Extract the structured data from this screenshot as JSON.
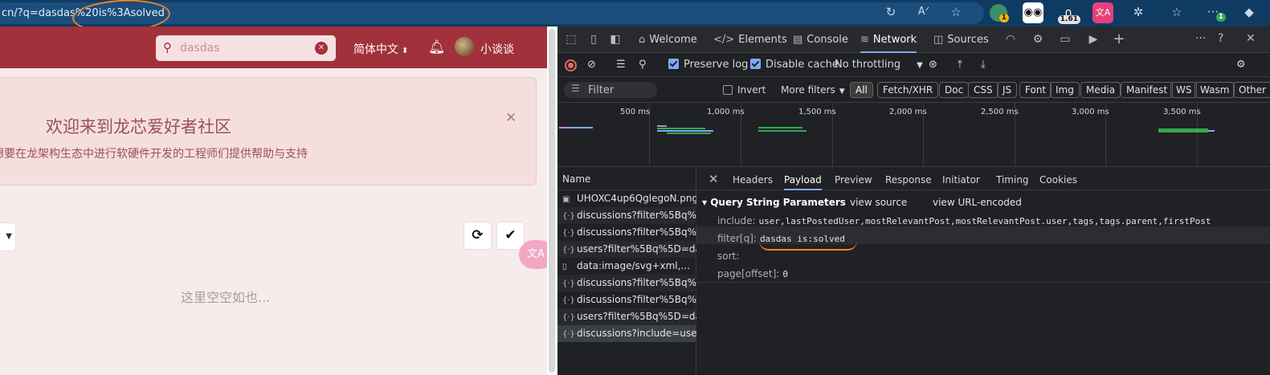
{
  "browser": {
    "url": "cn/?q=dasdas%20is%3Asolved",
    "ext_badges": {
      "ext1": "1",
      "ext3": "1.61",
      "ext_last": "1"
    }
  },
  "page": {
    "search_value": "dasdas",
    "language": "简体中文",
    "username": "小谈谈",
    "welcome_title": "欢迎来到龙芯爱好者社区",
    "welcome_subtitle": "想要在龙架构生态中进行软硬件开发的工程师们提供帮助与支持",
    "empty_text": "这里空空如也...",
    "translate_label": "文A"
  },
  "devtools": {
    "tabs": [
      {
        "label": "Welcome",
        "icon": "home-icon"
      },
      {
        "label": "Elements",
        "icon": "code-icon"
      },
      {
        "label": "Console",
        "icon": "console-icon"
      },
      {
        "label": "Network",
        "icon": "wifi-icon"
      },
      {
        "label": "Sources",
        "icon": "sources-icon"
      }
    ],
    "toolbar": {
      "preserve_log": "Preserve log",
      "disable_cache": "Disable cache",
      "throttling": "No throttling"
    },
    "filter": {
      "placeholder": "Filter",
      "invert": "Invert",
      "more_filters": "More filters",
      "chips": [
        "All",
        "Fetch/XHR",
        "Doc",
        "CSS",
        "JS",
        "Font",
        "Img",
        "Media",
        "Manifest",
        "WS",
        "Wasm",
        "Other"
      ]
    },
    "timeline_labels": [
      "500 ms",
      "1,000 ms",
      "1,500 ms",
      "2,000 ms",
      "2,500 ms",
      "3,000 ms",
      "3,500 ms"
    ],
    "name_header": "Name",
    "requests": [
      "UHOXC4up6QglegoN.png",
      "discussions?filter%5Bq%5...",
      "discussions?filter%5Bq%5...",
      "users?filter%5Bq%5D=da...",
      "data:image/svg+xml,...",
      "discussions?filter%5Bq%5...",
      "discussions?filter%5Bq%5...",
      "users?filter%5Bq%5D=da...",
      "discussions?include=user..."
    ],
    "detail_tabs": [
      "Headers",
      "Payload",
      "Preview",
      "Response",
      "Initiator",
      "Timing",
      "Cookies"
    ],
    "payload": {
      "section_title": "Query String Parameters",
      "view_source": "view source",
      "view_url_encoded": "view URL-encoded",
      "params": [
        {
          "key": "include:",
          "value": "user,lastPostedUser,mostRelevantPost,mostRelevantPost.user,tags,tags.parent,firstPost"
        },
        {
          "key": "filter[q]:",
          "value": "dasdas is:solved"
        },
        {
          "key": "sort:",
          "value": ""
        },
        {
          "key": "page[offset]:",
          "value": "0"
        }
      ]
    }
  },
  "colors": {
    "header_red": "#a1313a",
    "devtools_accent": "#7cacf8",
    "annotation_orange": "#e8832c",
    "timeline_green": "#34a853",
    "timeline_blue": "#7cacf8"
  }
}
